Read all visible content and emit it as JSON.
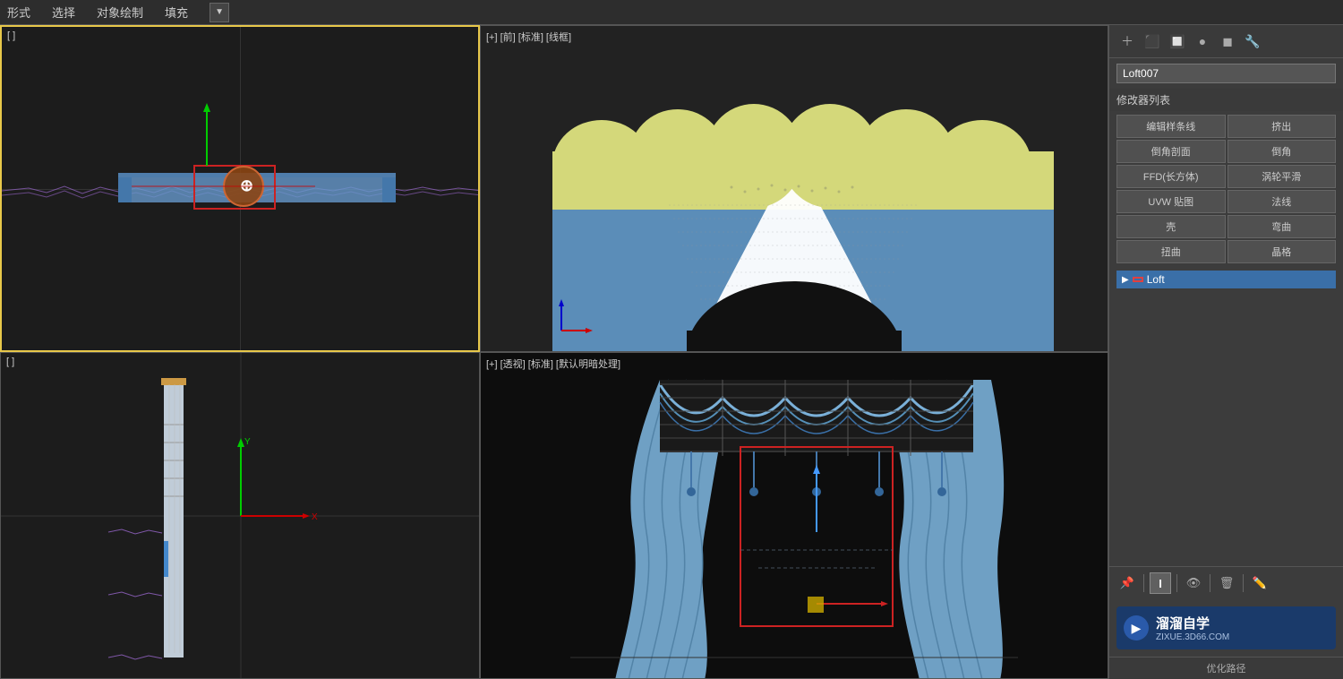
{
  "menubar": {
    "items": [
      "形式",
      "选择",
      "对象绘制",
      "填充"
    ]
  },
  "viewports": {
    "top_left": {
      "label": "[  ]",
      "type": "orthographic"
    },
    "top_right": {
      "label": "[+] [前] [标准] [线框]",
      "type": "front_wireframe"
    },
    "bottom_left": {
      "label": "[  ]",
      "type": "orthographic2"
    },
    "bottom_right": {
      "label": "[+] [透视] [标准] [默认明暗处理]",
      "type": "perspective"
    }
  },
  "right_panel": {
    "object_name": "Loft007",
    "modifier_list_label": "修改器列表",
    "modifier_buttons": [
      "编辑样条线",
      "挤出",
      "倒角剖面",
      "倒角",
      "FFD(长方体)",
      "涡轮平滑",
      "UVW 贴图",
      "法线",
      "壳",
      "弯曲",
      "扭曲",
      "晶格"
    ],
    "active_modifier": "Loft",
    "bottom_label": "优化路径",
    "watermark": {
      "text": "溜溜自学",
      "sub": "ZIXUE.3D66.COM"
    }
  }
}
